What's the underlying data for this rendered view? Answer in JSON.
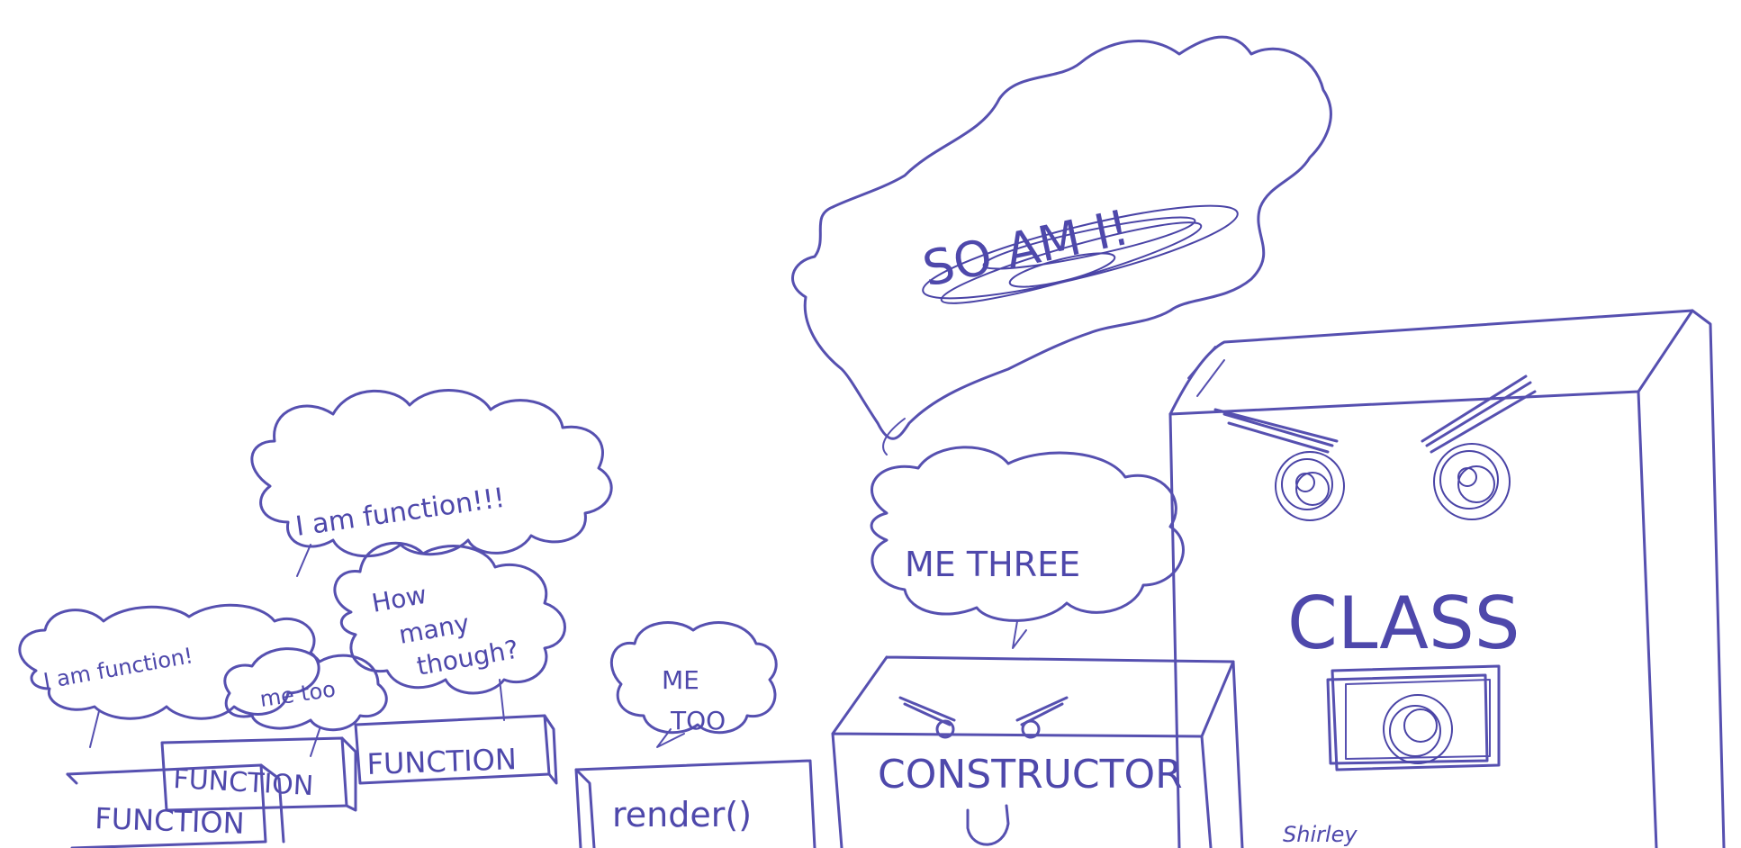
{
  "bubbles": {
    "so_am_i": "SO AM I!",
    "i_am_function_big": "I am function!!!",
    "how_many": [
      "How",
      "many",
      "though?"
    ],
    "i_am_function_small": "I am function!",
    "me_too_small": "me too",
    "me_too_render": [
      "ME",
      "TOO"
    ],
    "me_three": "ME THREE"
  },
  "boxes": {
    "function_1": "FUNCTION",
    "function_2": "FUNCTION",
    "function_3": "FUNCTION",
    "render": "render()",
    "constructor": "CONSTRUCTOR",
    "class": "CLASS"
  },
  "signature": "Shirley",
  "colors": {
    "ink": "#5650b0",
    "background": "#ffffff"
  }
}
